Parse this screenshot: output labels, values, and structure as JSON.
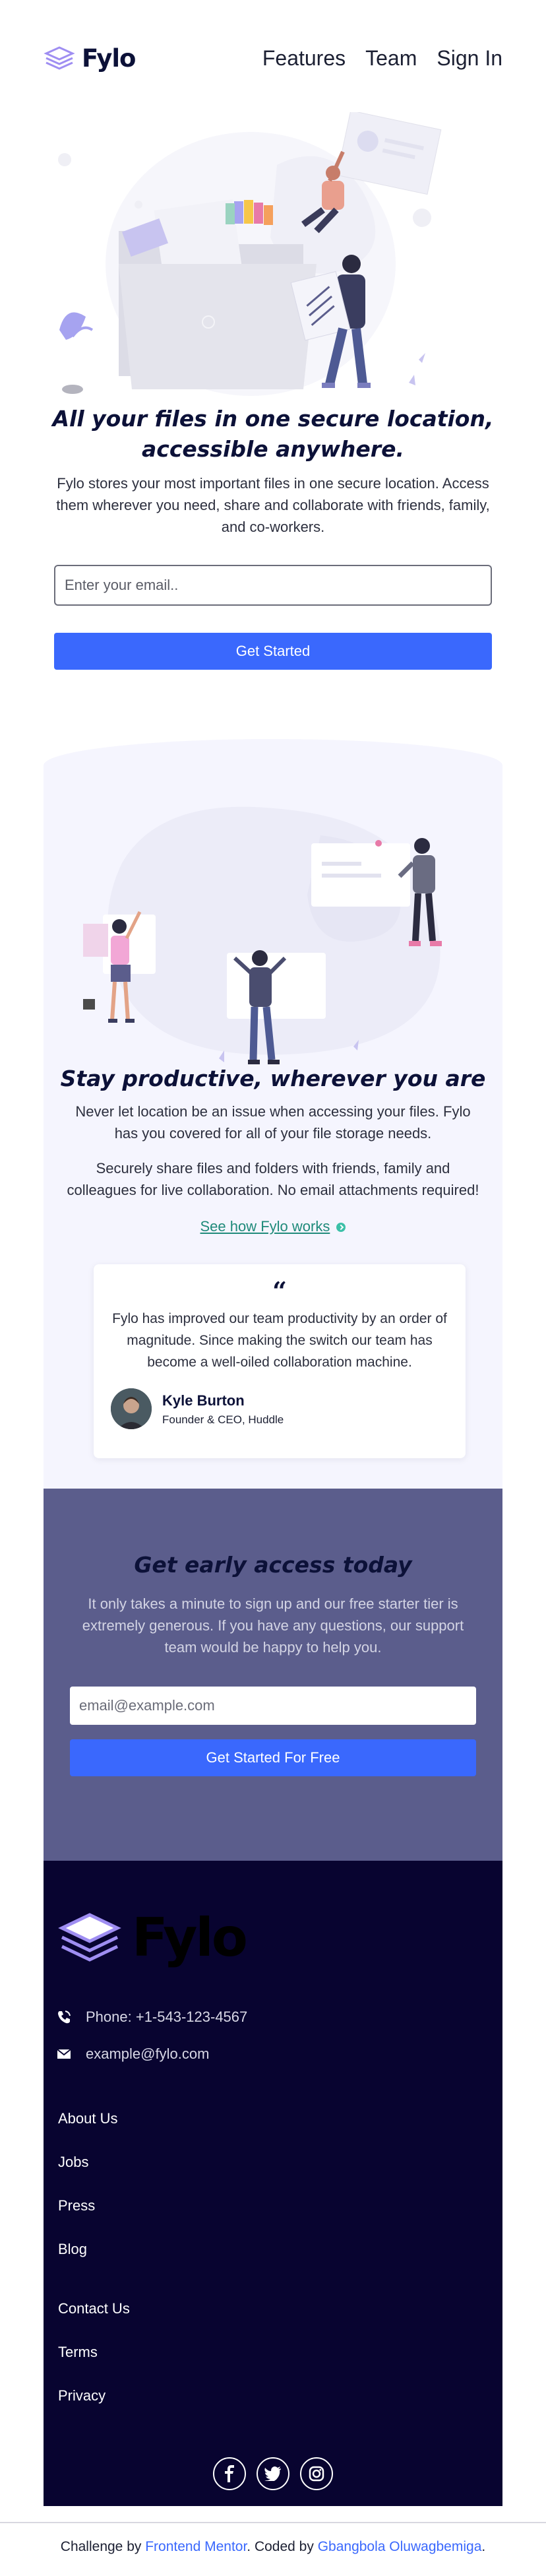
{
  "header": {
    "logo_text": "Fylo",
    "nav": [
      "Features",
      "Team",
      "Sign In"
    ]
  },
  "hero": {
    "title": "All your files in one secure location, accessible anywhere.",
    "text": "Fylo stores your most important files in one secure location. Access them wherever you need, share and collaborate with friends, family, and co-workers.",
    "email_placeholder": "Enter your email..",
    "button": "Get Started"
  },
  "productive": {
    "title": "Stay productive, wherever you are",
    "p1": "Never let location be an issue when accessing your files. Fylo has you covered for all of your file storage needs.",
    "p2": "Securely share files and folders with friends, family and colleagues for live collaboration. No email attachments required!",
    "link": "See how Fylo works",
    "testimonial": {
      "quote_mark": "“",
      "text": "Fylo has improved our team productivity by an order of magnitude. Since making the switch our team has become a well-oiled collaboration machine.",
      "name": "Kyle Burton",
      "role": "Founder & CEO, Huddle"
    }
  },
  "early": {
    "title": "Get early access today",
    "text": "It only takes a minute to sign up and our free starter tier is extremely generous. If you have any questions, our support team would be happy to help you.",
    "email_placeholder": "email@example.com",
    "button": "Get Started For Free"
  },
  "footer": {
    "logo_text": "Fylo",
    "phone": "Phone: +1-543-123-4567",
    "email": "example@fylo.com",
    "links_a": [
      "About Us",
      "Jobs",
      "Press",
      "Blog"
    ],
    "links_b": [
      "Contact Us",
      "Terms",
      "Privacy"
    ],
    "socials": [
      "facebook-icon",
      "twitter-icon",
      "instagram-icon"
    ]
  },
  "attribution": {
    "prefix": "Challenge by ",
    "fm": "Frontend Mentor",
    "mid": ". Coded by ",
    "author": "Gbangbola Oluwagbemiga",
    "suffix": "."
  },
  "colors": {
    "accent": "#3a68fd",
    "navy": "#0c1138",
    "footer_bg": "#080430",
    "early_bg": "#5b5d8c",
    "section_bg": "#f5f5fe",
    "link_teal": "#1f8a7a"
  }
}
